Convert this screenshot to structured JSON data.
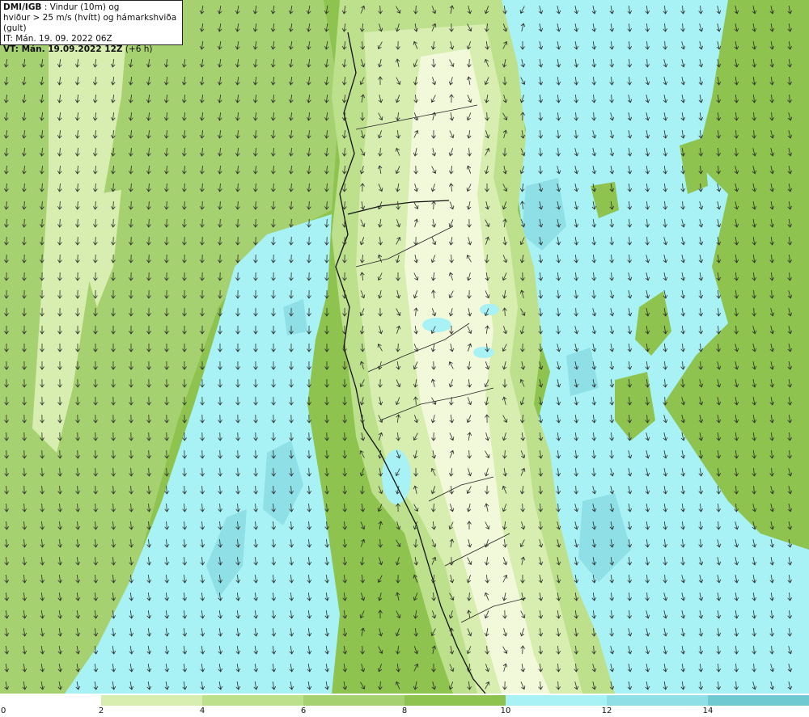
{
  "title": {
    "source": "DMI/IGB",
    "line1_rest": " : Vindur (10m) og",
    "line2": "hviður > 25 m/s (hvítt) og hámarkshviða (gult)",
    "line3": "IT: Mán. 19. 09. 2022 06Z",
    "line4_bold": "VT: Mán. 19.09.2022 12Z",
    "line4_rest": " (+6 h)"
  },
  "legend": {
    "colors": [
      "#ffffff",
      "#d7eeb0",
      "#bde08c",
      "#a6d170",
      "#8dc34e",
      "#a8f2f6",
      "#8fdfe6",
      "#6ec9d0",
      "#35a7ab"
    ],
    "ticks": [
      "0",
      "2",
      "4",
      "6",
      "8",
      "10",
      "12",
      "14"
    ]
  },
  "map": {
    "palette": {
      "ocean_mid": "#8dc34e",
      "ocean_light": "#a6d170",
      "ocean_pale": "#d7eeb0",
      "cyan": "#a8f2f6",
      "cyan_dark": "#8fdfe6",
      "land_pale": "#f2f9da",
      "land_light": "#d7eeb0",
      "land_mid": "#bde08c",
      "coast": "#111111",
      "arrow": "#2a2a2a"
    },
    "wind_arrows": "arrow-icon"
  }
}
